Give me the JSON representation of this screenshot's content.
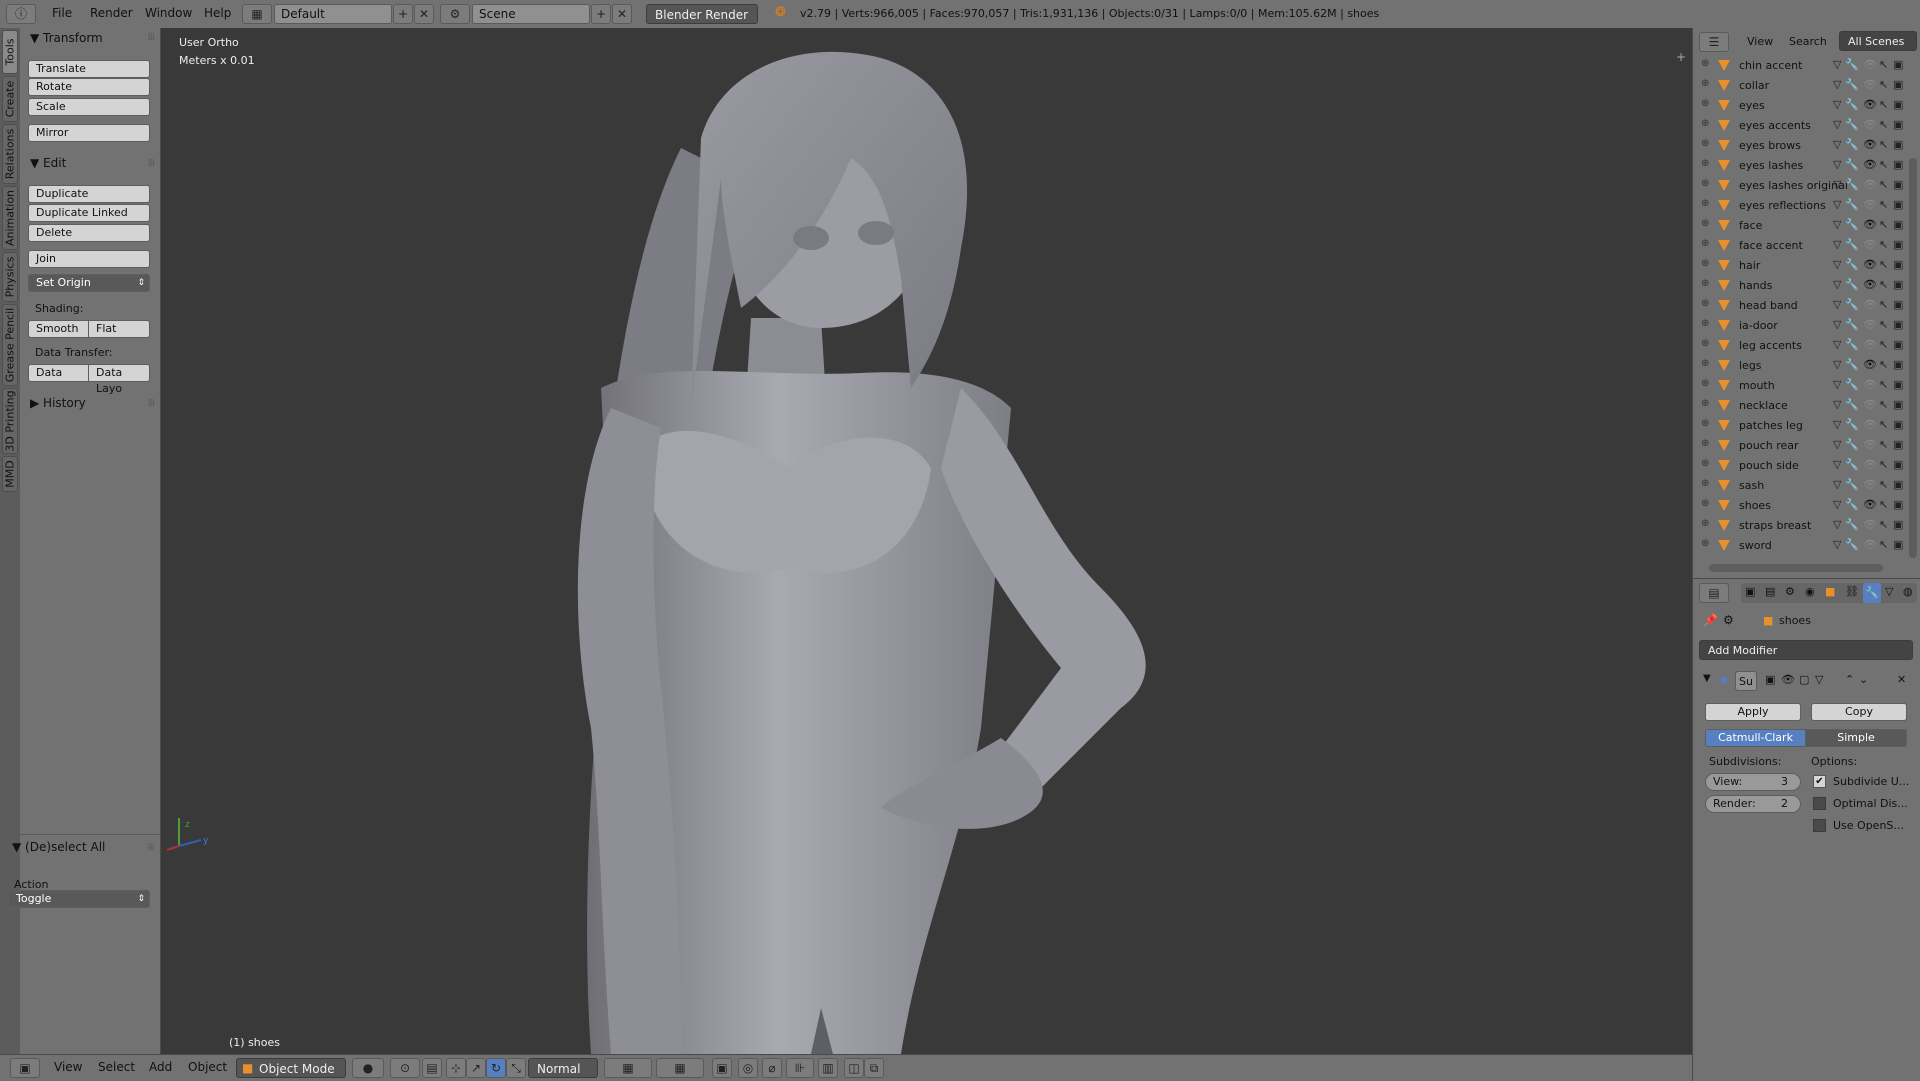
{
  "topbar": {
    "menus": [
      "File",
      "Render",
      "Window",
      "Help"
    ],
    "screen_layout": "Default",
    "scene": "Scene",
    "render_engine": "Blender Render",
    "stats": "v2.79 | Verts:966,005 | Faces:970,057 | Tris:1,931,136 | Objects:0/31 | Lamps:0/0 | Mem:105.62M | shoes"
  },
  "left_tabs": [
    "Tools",
    "Create",
    "Relations",
    "Animation",
    "Physics",
    "Grease Pencil",
    "3D Printing",
    "MMD"
  ],
  "toolshelf": {
    "transform_title": "Transform",
    "transform_buttons": [
      "Translate",
      "Rotate",
      "Scale"
    ],
    "mirror": "Mirror",
    "edit_title": "Edit",
    "edit_buttons": [
      "Duplicate",
      "Duplicate Linked",
      "Delete"
    ],
    "join": "Join",
    "set_origin": "Set Origin",
    "shading_label": "Shading:",
    "shading_smooth": "Smooth",
    "shading_flat": "Flat",
    "data_transfer_label": "Data Transfer:",
    "data_btn": "Data",
    "data_layo_btn": "Data Layo",
    "history_title": "History",
    "operator_title": "(De)select All",
    "action_label": "Action",
    "action_value": "Toggle"
  },
  "viewport": {
    "view_name": "User Ortho",
    "units": "Meters x 0.01",
    "active_object": "(1) shoes"
  },
  "bottombar": {
    "menus": [
      "View",
      "Select",
      "Add",
      "Object"
    ],
    "mode": "Object Mode",
    "orientation": "Normal"
  },
  "outliner": {
    "tabs": [
      "View",
      "Search",
      "All Scenes"
    ],
    "items": [
      {
        "name": "chin accent",
        "visible": false
      },
      {
        "name": "collar",
        "visible": false
      },
      {
        "name": "eyes",
        "visible": true
      },
      {
        "name": "eyes accents",
        "visible": false
      },
      {
        "name": "eyes brows",
        "visible": true
      },
      {
        "name": "eyes lashes",
        "visible": true
      },
      {
        "name": "eyes lashes original",
        "visible": false
      },
      {
        "name": "eyes reflections",
        "visible": false
      },
      {
        "name": "face",
        "visible": true
      },
      {
        "name": "face accent",
        "visible": false
      },
      {
        "name": "hair",
        "visible": true
      },
      {
        "name": "hands",
        "visible": true
      },
      {
        "name": "head band",
        "visible": false
      },
      {
        "name": "ia-door",
        "visible": false
      },
      {
        "name": "leg accents",
        "visible": false
      },
      {
        "name": "legs",
        "visible": true
      },
      {
        "name": "mouth",
        "visible": false
      },
      {
        "name": "necklace",
        "visible": false
      },
      {
        "name": "patches leg",
        "visible": false
      },
      {
        "name": "pouch rear",
        "visible": false
      },
      {
        "name": "pouch side",
        "visible": false
      },
      {
        "name": "sash",
        "visible": false
      },
      {
        "name": "shoes",
        "visible": true
      },
      {
        "name": "straps breast",
        "visible": false
      },
      {
        "name": "sword",
        "visible": false
      }
    ]
  },
  "properties": {
    "object": "shoes",
    "add_modifier": "Add Modifier",
    "modifier_short": "Su",
    "apply": "Apply",
    "copy": "Copy",
    "algo_catmull": "Catmull-Clark",
    "algo_simple": "Simple",
    "subdivisions_label": "Subdivisions:",
    "view_label": "View:",
    "view_value": "3",
    "render_label": "Render:",
    "render_value": "2",
    "options_label": "Options:",
    "opt1": "Subdivide U...",
    "opt2": "Optimal Dis...",
    "opt3": "Use OpenS..."
  }
}
